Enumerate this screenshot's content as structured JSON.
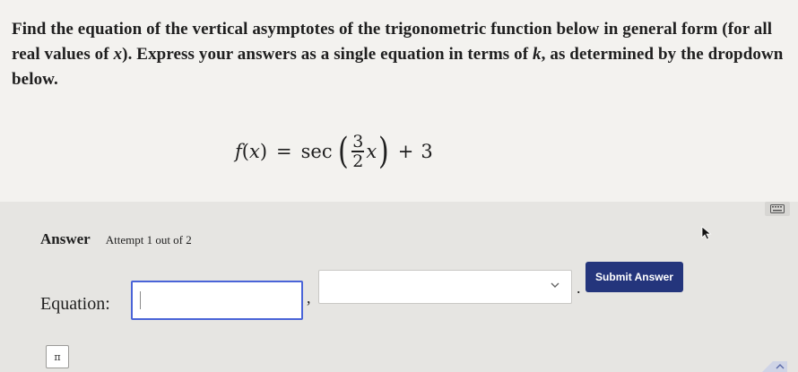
{
  "question": {
    "part1": "Find the equation of the vertical asymptotes of the trigonometric function below in general form (for all real values of ",
    "var_x": "x",
    "part2": "). Express your answers as a single equation in terms of ",
    "var_k": "k",
    "part3": ", as determined by the dropdown below."
  },
  "formula": {
    "lhs_fn": "f",
    "lhs_open": "(",
    "lhs_var": "x",
    "lhs_close": ")",
    "equals": "=",
    "func": "sec",
    "paren_open": "(",
    "numerator": "3",
    "denominator": "2",
    "inner_var": "x",
    "paren_close": ")",
    "plus": "+",
    "constant": "3"
  },
  "answer": {
    "title": "Answer",
    "attempt": "Attempt 1 out of 2",
    "equation_label": "Equation:",
    "equation_value": "",
    "comma": ",",
    "dropdown_selected": "",
    "period": ".",
    "submit_label": "Submit Answer",
    "pi_label": "π"
  },
  "icons": {
    "keyboard": "keyboard-icon",
    "cursor": "mouse-pointer-icon",
    "chevron": "chevron-down-icon"
  },
  "colors": {
    "submit_bg": "#24357c",
    "input_border": "#4a64d8",
    "panel_bg": "#e6e5e2",
    "page_bg": "#f3f2ef"
  }
}
